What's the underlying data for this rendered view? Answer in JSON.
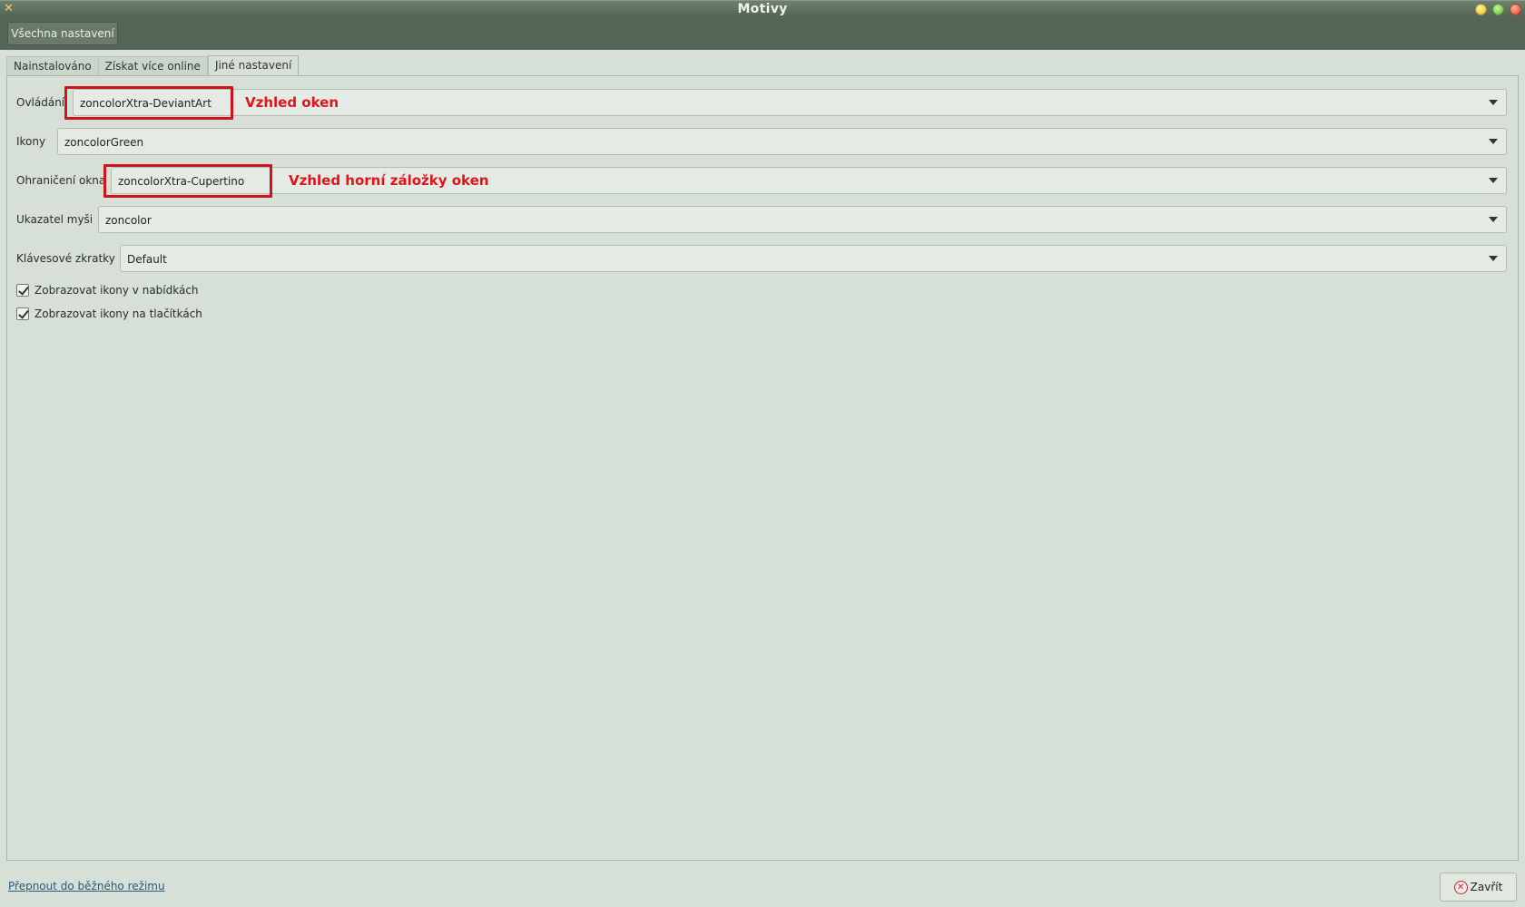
{
  "window": {
    "title": "Motivy",
    "app_icon": "tools-icon",
    "buttons": [
      "minimize",
      "maximize",
      "close"
    ]
  },
  "toolbar": {
    "all_settings_label": "Všechna nastavení"
  },
  "tabs": [
    {
      "label": "Nainstalováno",
      "active": false
    },
    {
      "label": "Získat více online",
      "active": false
    },
    {
      "label": "Jiné nastavení",
      "active": true
    }
  ],
  "settings": {
    "controls": {
      "label": "Ovládání",
      "value": "zoncolorXtra-DeviantArt",
      "annotation": "Vzhled oken"
    },
    "icons": {
      "label": "Ikony",
      "value": "zoncolorGreen"
    },
    "window_border": {
      "label": "Ohraničení okna",
      "value": "zoncolorXtra-Cupertino",
      "annotation": "Vzhled horní záložky oken"
    },
    "mouse_pointer": {
      "label": "Ukazatel myši",
      "value": "zoncolor"
    },
    "keyboard_shortcuts": {
      "label": "Klávesové zkratky",
      "value": "Default"
    }
  },
  "checkboxes": [
    {
      "label": "Zobrazovat ikony v nabídkách",
      "checked": true
    },
    {
      "label": "Zobrazovat ikony na tlačítkách",
      "checked": true
    }
  ],
  "footer": {
    "switch_mode_link": "Přepnout do běžného režimu",
    "close_label": "Zavřít"
  },
  "colors": {
    "titlebar": "#566656",
    "background": "#d6e0d6",
    "annotation_red": "#e0141a"
  }
}
